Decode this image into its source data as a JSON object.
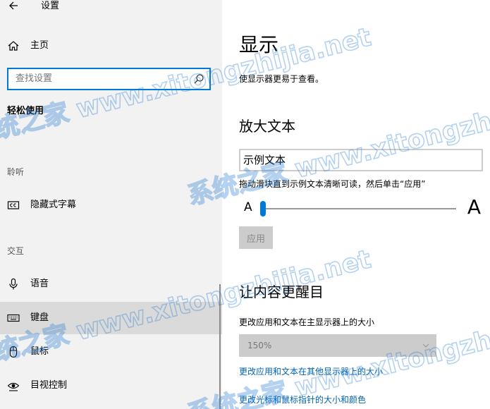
{
  "window": {
    "title": "设置"
  },
  "sidebar": {
    "home_label": "主页",
    "search_placeholder": "查找设置",
    "section_title": "轻松使用",
    "group_hearing": "聆听",
    "group_interaction": "交互",
    "items": [
      {
        "label": "隐藏式字幕",
        "icon": "closed-captions-icon"
      },
      {
        "label": "语音",
        "icon": "microphone-icon"
      },
      {
        "label": "键盘",
        "icon": "keyboard-icon",
        "selected": true
      },
      {
        "label": "鼠标",
        "icon": "mouse-icon"
      },
      {
        "label": "目视控制",
        "icon": "eye-control-icon"
      }
    ]
  },
  "main": {
    "title": "显示",
    "description": "使显示器更易于查看。",
    "text_section": {
      "heading": "放大文本",
      "sample_text": "示例文本",
      "hint": "拖动滑块直到示例文本清晰可读，然后单击“应用”",
      "small_a": "A",
      "large_a": "A",
      "slider_value_fraction": 0.0,
      "apply_label": "应用"
    },
    "bright_section": {
      "heading": "让内容更醒目",
      "scale_label": "更改应用和文本在主显示器上的大小",
      "scale_value": "150%",
      "link_other_display": "更改应用和文本在其他显示器上的大小",
      "link_cursor": "更改光标和鼠标指针的大小和颜色"
    }
  },
  "watermark": {
    "lines": [
      "系统之家 www.xitongzhijia.net"
    ],
    "color": "#2a7fd4"
  },
  "colors": {
    "accent": "#0078d7",
    "link": "#0063b1",
    "sidebar_bg": "#f2f2f2",
    "selected_bg": "#dadada"
  }
}
